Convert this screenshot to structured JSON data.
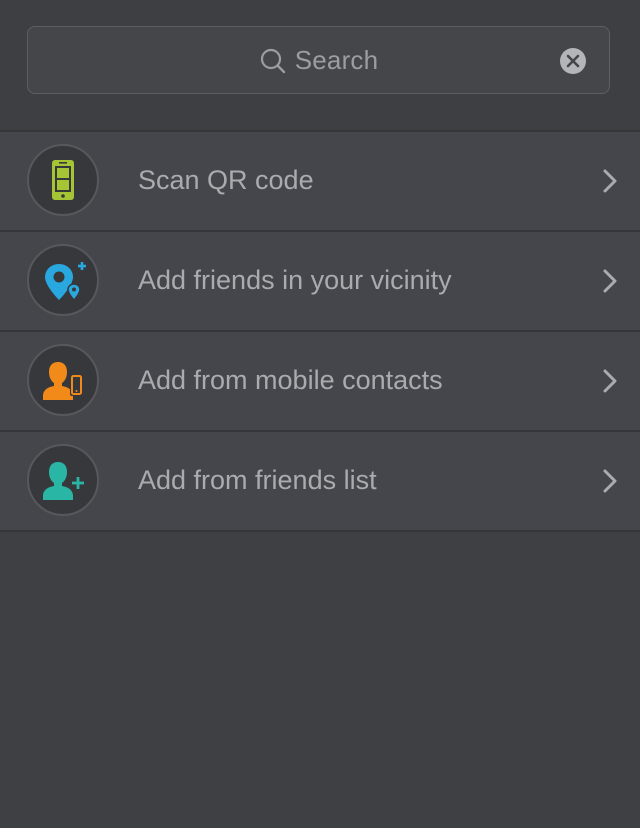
{
  "search": {
    "placeholder": "Search"
  },
  "menu": {
    "items": [
      {
        "label": "Scan QR code",
        "icon": "qr-phone-icon",
        "color": "#a5c535"
      },
      {
        "label": "Add friends in your vicinity",
        "icon": "location-add-icon",
        "color": "#29a8e0"
      },
      {
        "label": "Add from mobile contacts",
        "icon": "contact-phone-icon",
        "color": "#f28a1a"
      },
      {
        "label": "Add from friends list",
        "icon": "friend-add-icon",
        "color": "#2ab6a4"
      }
    ]
  },
  "colors": {
    "background": "#3f4044",
    "row": "#45464b",
    "text": "#a9abaf"
  }
}
